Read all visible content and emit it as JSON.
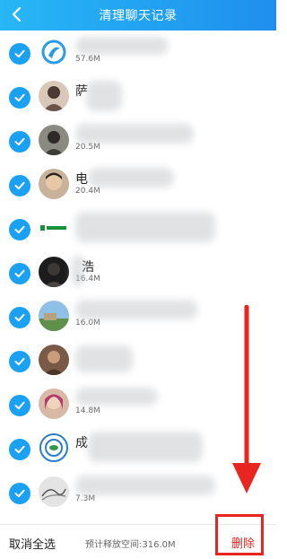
{
  "header": {
    "title": "清理聊天记录",
    "back_icon": "chevron-left-icon"
  },
  "colors": {
    "header": "#1f8fee",
    "check": "#1aa1f4",
    "delete": "#e8261f"
  },
  "chats": [
    {
      "name": "",
      "size": "57.6M",
      "avatar": "swirl-logo"
    },
    {
      "name": "萨",
      "size": "",
      "avatar": "person-photo"
    },
    {
      "name": "",
      "size": "20.5M",
      "avatar": "person-photo"
    },
    {
      "name": "电",
      "size": "20.4M",
      "avatar": "person-photo"
    },
    {
      "name": "",
      "size": "",
      "avatar": "green-logo"
    },
    {
      "name": "浩",
      "size": "16.4M",
      "avatar": "dark-photo"
    },
    {
      "name": "",
      "size": "16.0M",
      "avatar": "landscape-photo"
    },
    {
      "name": "",
      "size": "",
      "avatar": "person-photo"
    },
    {
      "name": "",
      "size": "14.8M",
      "avatar": "person-photo"
    },
    {
      "name": "成",
      "size": "",
      "avatar": "badge-logo"
    },
    {
      "name": "",
      "size": "7.3M",
      "avatar": "sketch-photo"
    }
  ],
  "footer": {
    "select_all": "取消全选",
    "release": "预计释放空间:316.0M",
    "delete": "删除"
  }
}
